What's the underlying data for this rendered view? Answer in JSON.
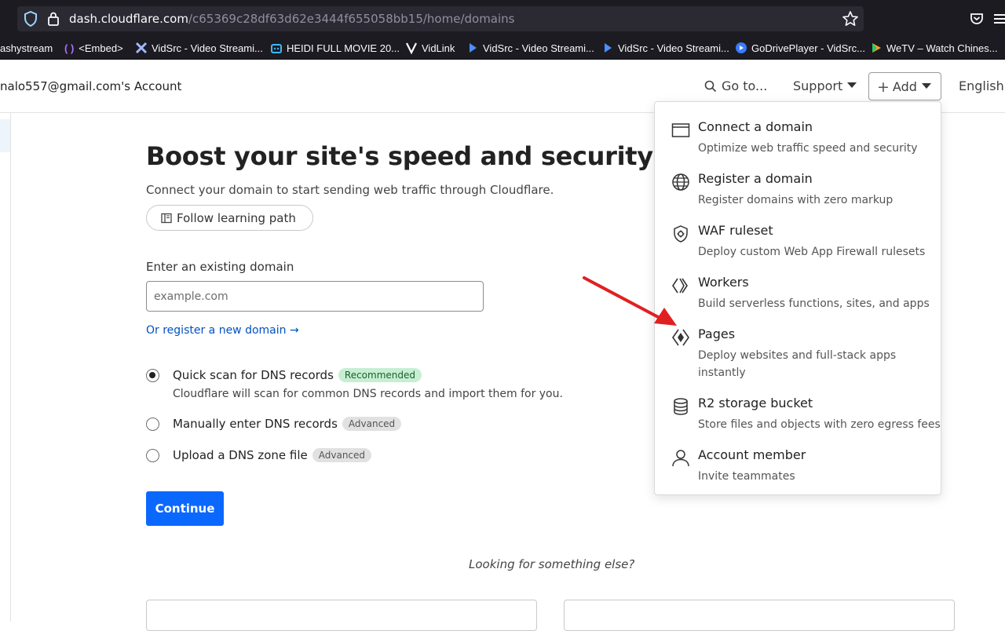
{
  "browser": {
    "url_host": "dash.cloudflare.com",
    "url_path": "/c65369c28df63d62e3444f655058bb15/home/domains",
    "bookmarks": [
      {
        "label": "ashystream",
        "icon": "bookmark-icon",
        "color": "#fbfbfe"
      },
      {
        "label": "<Embed>",
        "icon": "code-icon",
        "color": "#a970ff"
      },
      {
        "label": "VidSrc - Video Streami...",
        "icon": "vidsrc-icon",
        "color": "#9fb8ff"
      },
      {
        "label": "HEIDI FULL MOVIE 20...",
        "icon": "robot-icon",
        "color": "#3db8ff"
      },
      {
        "label": "VidLink",
        "icon": "v-icon",
        "color": "#ffffff"
      },
      {
        "label": "VidSrc - Video Streami...",
        "icon": "play-icon",
        "color": "#4a90ff"
      },
      {
        "label": "VidSrc - Video Streami...",
        "icon": "play-icon",
        "color": "#4a90ff"
      },
      {
        "label": "GoDrivePlayer - VidSrc...",
        "icon": "circle-play-icon",
        "color": "#3a7bff"
      },
      {
        "label": "WeTV – Watch Chines...",
        "icon": "wetv-icon",
        "color": "#ff9f1a"
      }
    ]
  },
  "header": {
    "account": "nalo557@gmail.com's Account",
    "goto": "Go to...",
    "support": "Support",
    "add": "Add",
    "language": "English"
  },
  "main": {
    "headline": "Boost your site's speed and security",
    "subtitle": "Connect your domain to start sending web traffic through Cloudflare.",
    "learning_path": "Follow learning path",
    "domain_label": "Enter an existing domain",
    "domain_placeholder": "example.com",
    "domain_value": "",
    "register_link": "Or register a new domain →",
    "options": [
      {
        "label": "Quick scan for DNS records",
        "badge": "Recommended",
        "badge_style": "green",
        "checked": true
      },
      {
        "label": "Manually enter DNS records",
        "badge": "Advanced",
        "badge_style": "gray",
        "checked": false
      },
      {
        "label": "Upload a DNS zone file",
        "badge": "Advanced",
        "badge_style": "gray",
        "checked": false
      }
    ],
    "quick_scan_desc": "Cloudflare will scan for common DNS records and import them for you.",
    "continue": "Continue",
    "looking": "Looking for something else?"
  },
  "dropdown": {
    "items": [
      {
        "title": "Connect a domain",
        "desc": "Optimize web traffic speed and security",
        "icon": "browser-window-icon"
      },
      {
        "title": "Register a domain",
        "desc": "Register domains with zero markup",
        "icon": "globe-icon"
      },
      {
        "title": "WAF ruleset",
        "desc": "Deploy custom Web App Firewall rulesets",
        "icon": "shield-gear-icon"
      },
      {
        "title": "Workers",
        "desc": "Build serverless functions, sites, and apps",
        "icon": "workers-icon"
      },
      {
        "title": "Pages",
        "desc": "Deploy websites and full-stack apps",
        "desc2": "instantly",
        "icon": "pages-icon"
      },
      {
        "title": "R2 storage bucket",
        "desc": "Store files and objects with zero egress fees",
        "icon": "database-icon"
      },
      {
        "title": "Account member",
        "desc": "Invite teammates",
        "icon": "person-icon"
      }
    ]
  },
  "colors": {
    "accent": "#0a68ff",
    "link": "#0051c3",
    "annotation_arrow": "#e02020"
  }
}
